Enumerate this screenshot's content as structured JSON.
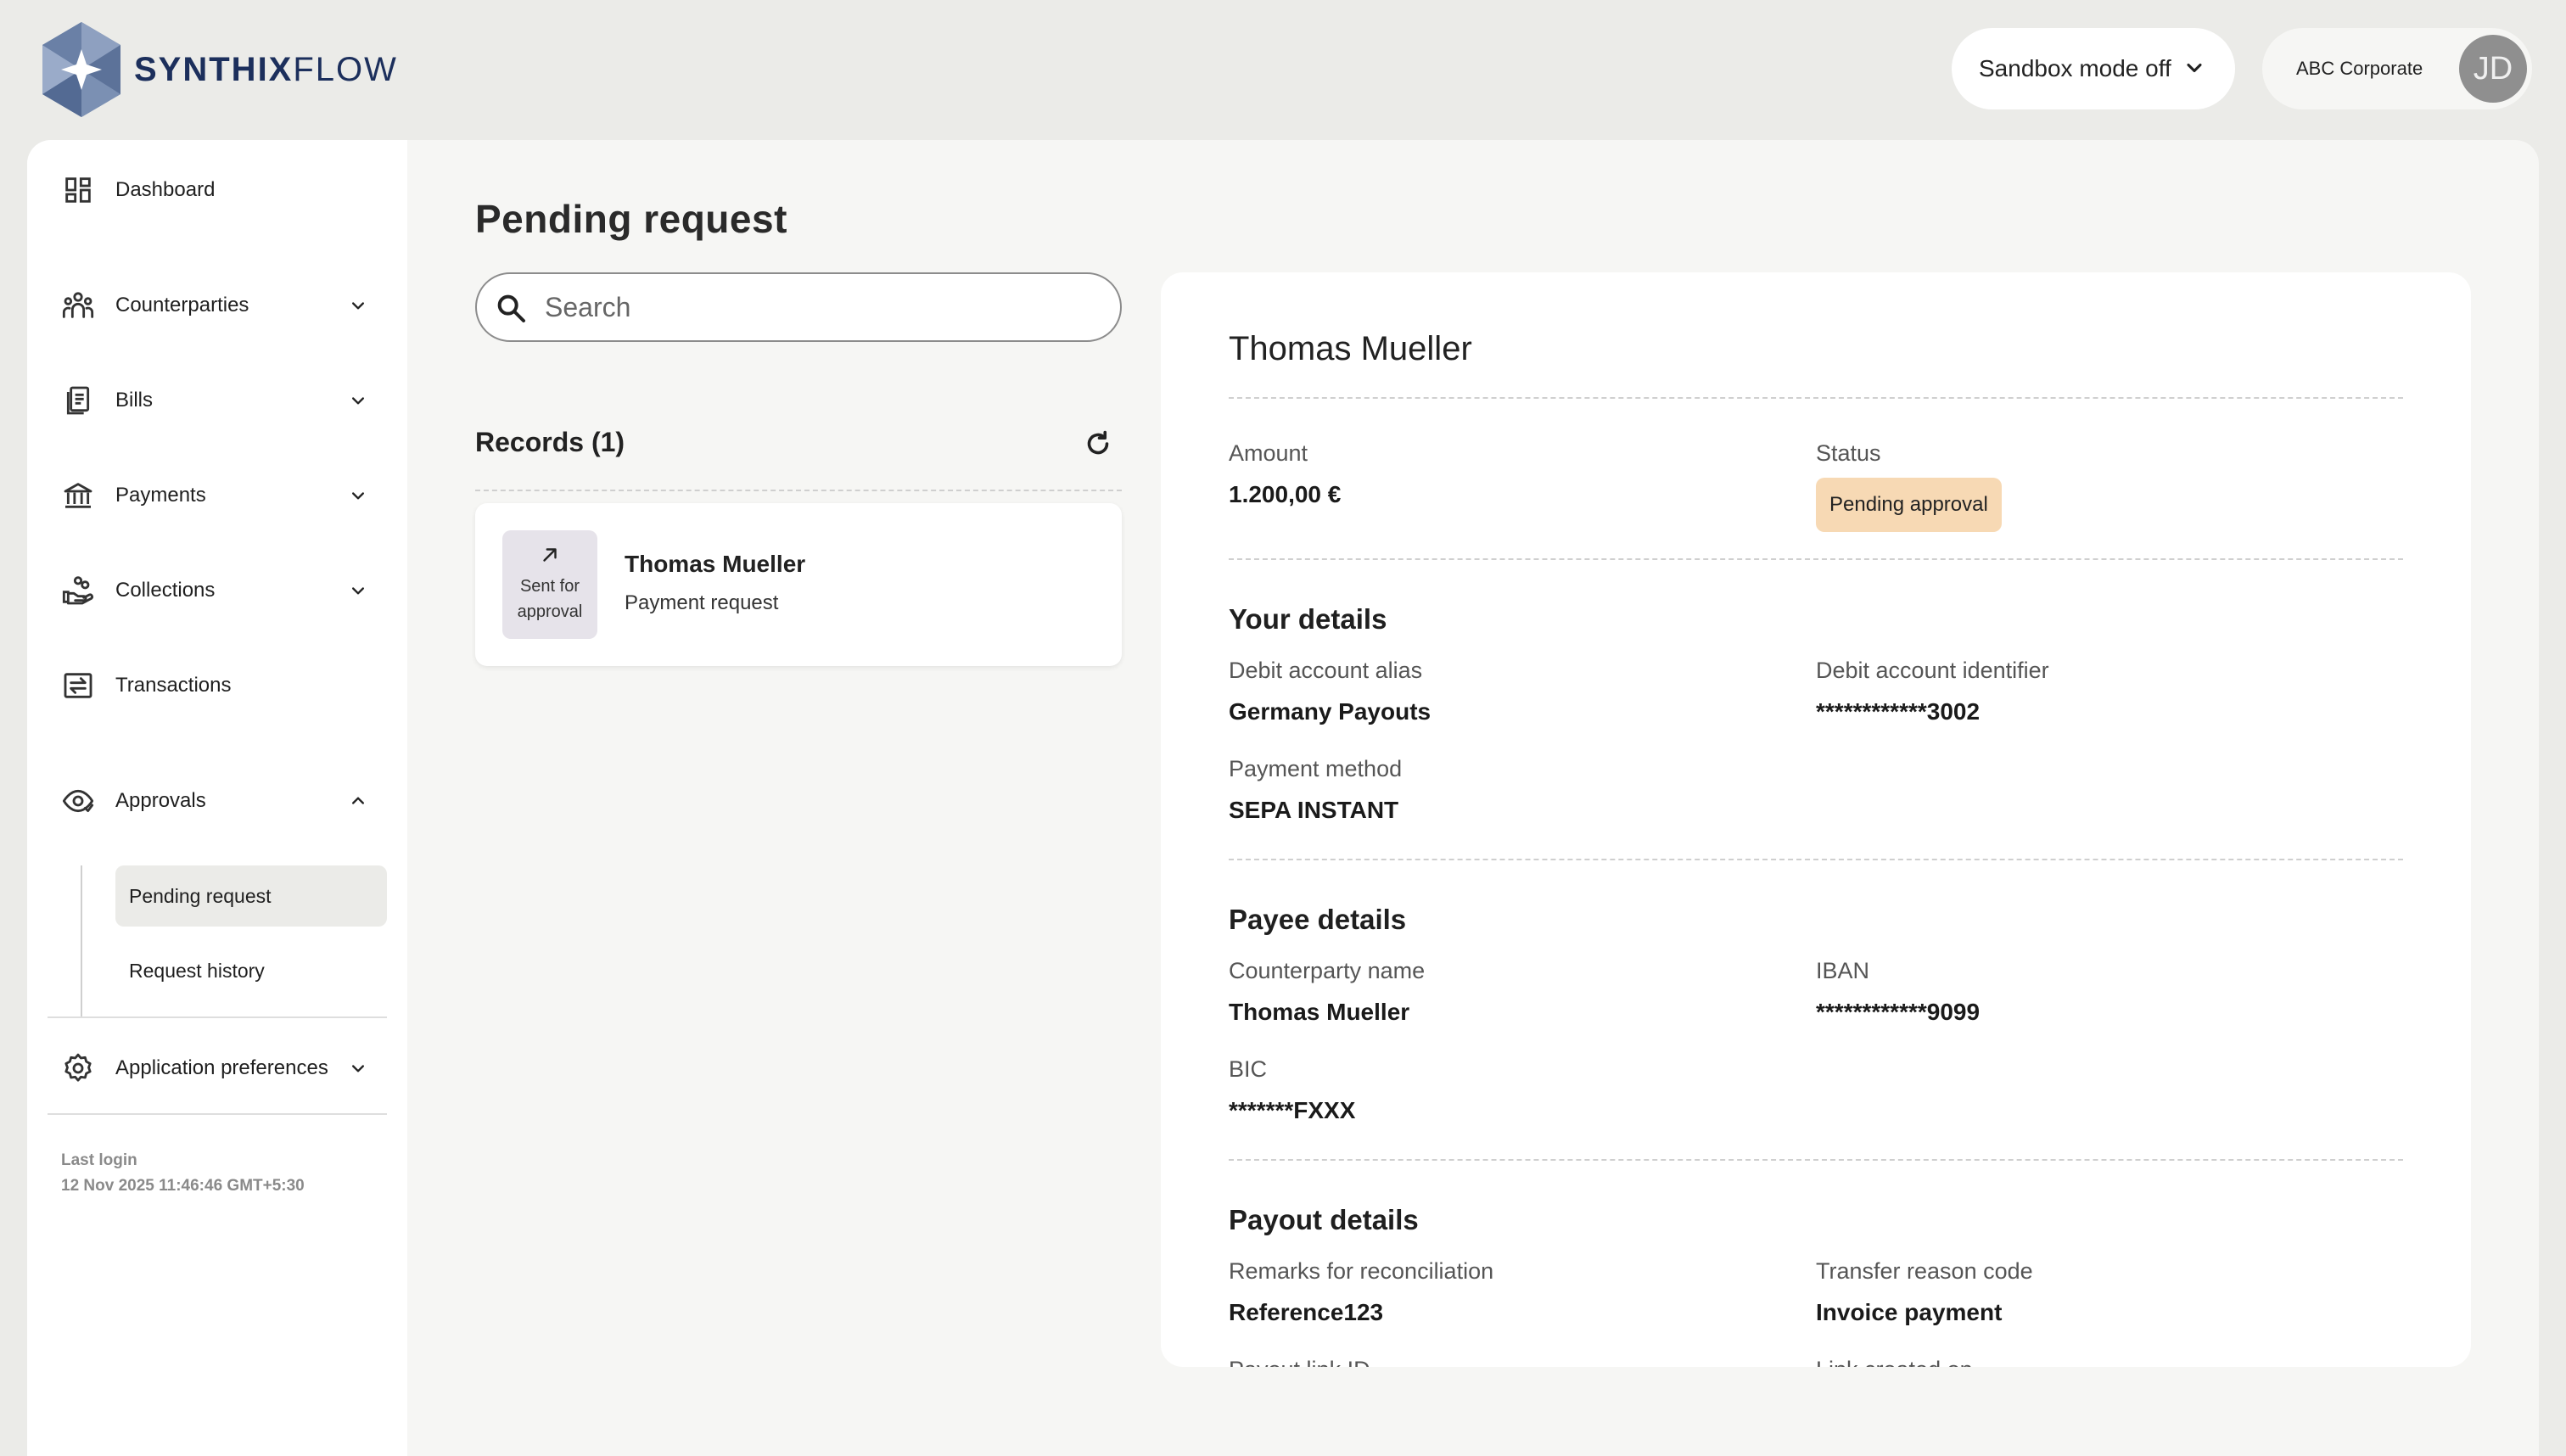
{
  "brand": {
    "name_bold": "SYNTHIX",
    "name_light": "FLOW"
  },
  "header": {
    "sandbox_label": "Sandbox mode off",
    "account_name": "ABC Corporate",
    "avatar_initials": "JD"
  },
  "sidebar": {
    "items": [
      {
        "label": "Dashboard",
        "icon": "dashboard-icon"
      },
      {
        "label": "Counterparties",
        "icon": "people-icon"
      },
      {
        "label": "Bills",
        "icon": "bills-icon"
      },
      {
        "label": "Payments",
        "icon": "bank-icon"
      },
      {
        "label": "Collections",
        "icon": "hand-coins-icon"
      },
      {
        "label": "Transactions",
        "icon": "exchange-icon"
      },
      {
        "label": "Approvals",
        "icon": "eye-check-icon"
      },
      {
        "label": "Application preferences",
        "icon": "gear-icon"
      }
    ],
    "approvals_sub": [
      "Pending request",
      "Request history"
    ],
    "last_login_label": "Last login",
    "last_login_value": "12 Nov 2025 11:46:46 GMT+5:30"
  },
  "main": {
    "title": "Pending request",
    "search_placeholder": "Search",
    "records_title": "Records (1)",
    "records": [
      {
        "badge_line1": "Sent for",
        "badge_line2": "approval",
        "name": "Thomas Mueller",
        "type": "Payment request"
      }
    ]
  },
  "detail": {
    "name": "Thomas Mueller",
    "amount_label": "Amount",
    "amount_value": "1.200,00 €",
    "status_label": "Status",
    "status_value": "Pending approval",
    "your_details": {
      "title": "Your details",
      "debit_alias_label": "Debit account alias",
      "debit_alias_value": "Germany Payouts",
      "debit_id_label": "Debit account identifier",
      "debit_id_value": "************3002",
      "payment_method_label": "Payment method",
      "payment_method_value": "SEPA INSTANT"
    },
    "payee_details": {
      "title": "Payee details",
      "counterparty_label": "Counterparty name",
      "counterparty_value": "Thomas Mueller",
      "iban_label": "IBAN",
      "iban_value": "************9099",
      "bic_label": "BIC",
      "bic_value": "*******FXXX"
    },
    "payout_details": {
      "title": "Payout details",
      "remarks_label": "Remarks for reconciliation",
      "remarks_value": "Reference123",
      "reason_label": "Transfer reason code",
      "reason_value": "Invoice payment",
      "link_id_label": "Payout link ID",
      "link_created_label": "Link created on"
    }
  },
  "colors": {
    "page_bg": "#ebebe8",
    "brand_navy": "#1c2f5c",
    "status_pending": "#f7d9b4",
    "active_nav": "#ebebe8"
  }
}
